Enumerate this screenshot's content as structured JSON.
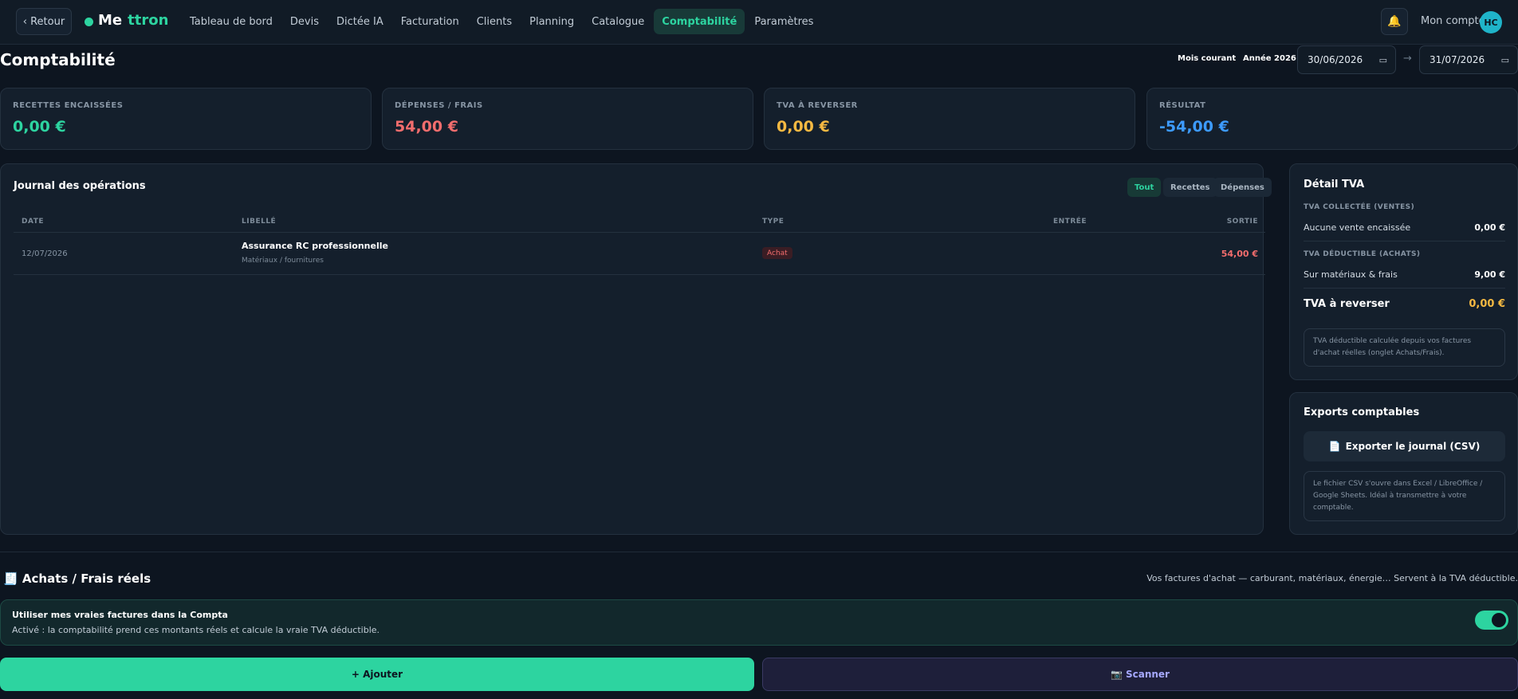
{
  "nav": {
    "back_label": "‹ Retour",
    "logo_part1": "Me",
    "logo_part2": "ttron",
    "links": [
      "Tableau de bord",
      "Devis",
      "Dictée IA",
      "Facturation",
      "Clients",
      "Planning",
      "Catalogue",
      "Comptabilité",
      "Paramètres"
    ],
    "active": "Comptabilité",
    "account_label": "Mon compte",
    "avatar_initials": "HC",
    "bell_icon": "bell-icon"
  },
  "header": {
    "title": "Comptabilité",
    "period_month": "Mois courant",
    "period_year": "Année 2026",
    "date_from": "30/06/2026",
    "date_to": "31/07/2026",
    "arrow": "→",
    "calendar_icon": "calendar-icon"
  },
  "stats": [
    {
      "label": "RECETTES ENCAISSÉES",
      "value": "0,00 €",
      "color": "#2dd4a0"
    },
    {
      "label": "DÉPENSES / FRAIS",
      "value": "54,00 €",
      "color": "#f26d6d"
    },
    {
      "label": "TVA À REVERSER",
      "value": "0,00 €",
      "color": "#f5b942"
    },
    {
      "label": "RÉSULTAT",
      "value": "-54,00 €",
      "color": "#3d9bff"
    }
  ],
  "journal": {
    "title": "Journal des opérations",
    "filters": [
      "Tout",
      "Recettes",
      "Dépenses"
    ],
    "active_filter": "Tout",
    "columns": [
      "DATE",
      "LIBELLÉ",
      "TYPE",
      "ENTRÉE",
      "SORTIE"
    ],
    "rows": [
      {
        "date": "12/07/2026",
        "label": "Assurance RC professionnelle",
        "sub": "Matériaux / fournitures",
        "type": "Achat",
        "entry": "",
        "out": "54,00 €"
      }
    ]
  },
  "tva": {
    "title": "Détail TVA",
    "collected_label": "TVA COLLECTÉE (VENTES)",
    "collected_line": "Aucune vente encaissée",
    "collected_amount": "0,00 €",
    "deductible_label": "TVA DÉDUCTIBLE (ACHATS)",
    "deductible_line": "Sur matériaux & frais",
    "deductible_amount": "9,00 €",
    "total_label": "TVA à reverser",
    "total_amount": "0,00 €",
    "note": "TVA déductible calculée depuis vos factures d'achat réelles (onglet Achats/Frais)."
  },
  "exports": {
    "title": "Exports comptables",
    "button_label": "Exporter le journal (CSV)",
    "button_icon": "document-icon",
    "note": "Le fichier CSV s'ouvre dans Excel / LibreOffice / Google Sheets. Idéal à transmettre à votre comptable."
  },
  "achats": {
    "icon": "receipt-icon",
    "title": "Achats / Frais réels",
    "description": "Vos factures d'achat — carburant, matériaux, énergie… Servent à la TVA déductible.",
    "toggle_title": "Utiliser mes vraies factures dans la Compta",
    "toggle_desc": "Activé : la comptabilité prend ces montants réels et calcule la vraie TVA déductible.",
    "toggle_on": true,
    "add_label": "+ Ajouter",
    "scan_label": "Scanner",
    "scan_icon": "camera-icon"
  }
}
